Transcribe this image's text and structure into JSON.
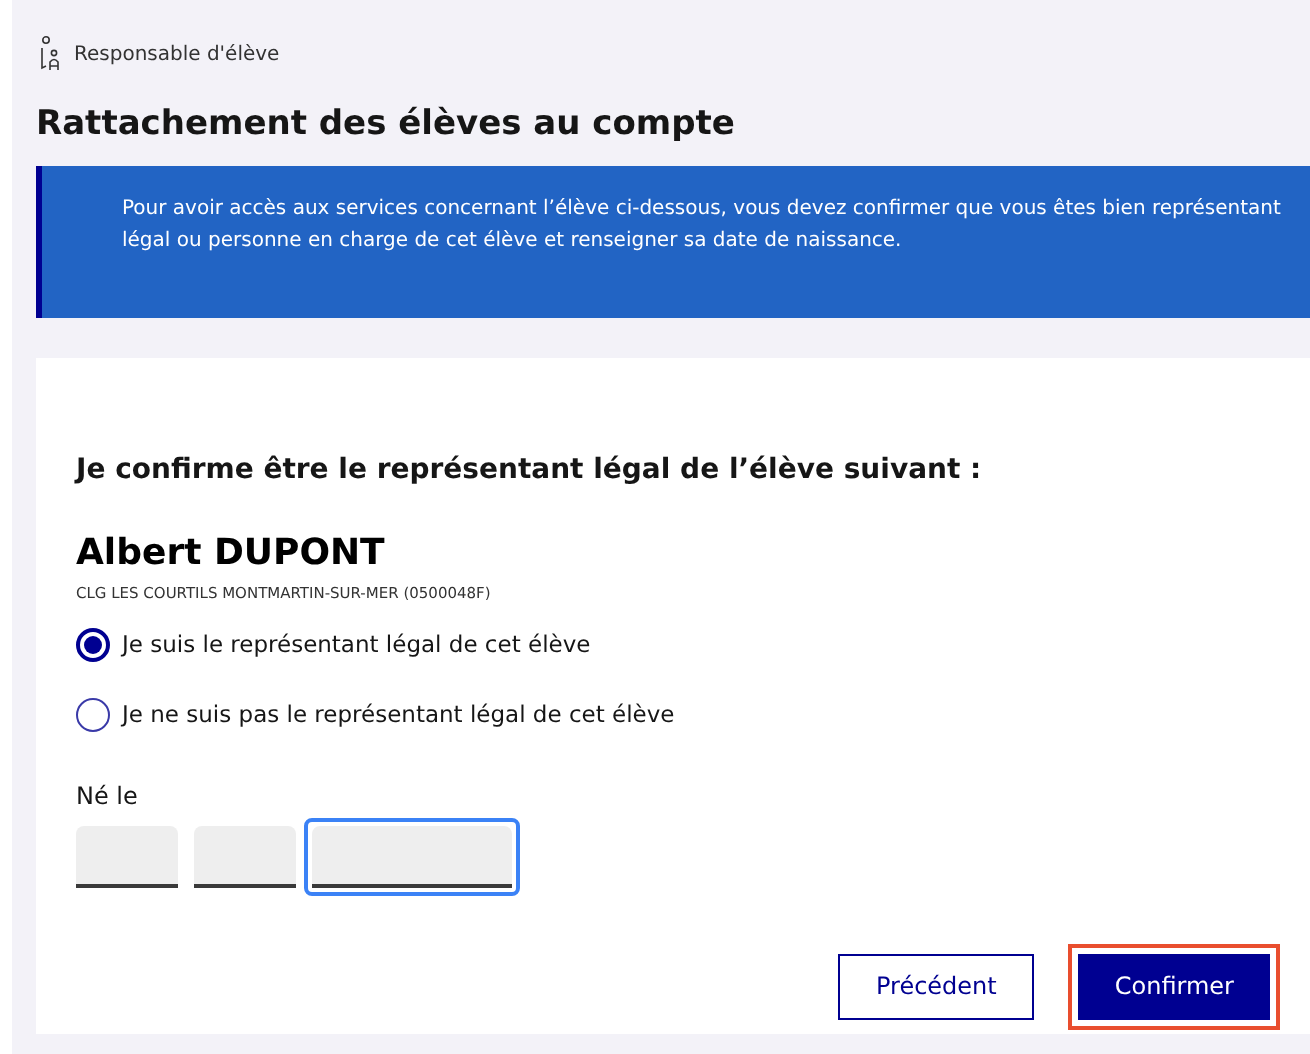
{
  "breadcrumb": {
    "label": "Responsable d'élève"
  },
  "title": "Rattachement des élèves au compte",
  "notice": "Pour avoir accès aux services concernant l’élève ci-dessous, vous devez confirmer que vous êtes bien représentant légal ou personne en charge de cet élève et renseigner sa date de naissance.",
  "form": {
    "heading": "Je confirme être le représentant légal de l’élève suivant :",
    "student_name": "Albert DUPONT",
    "school": "CLG LES COURTILS MONTMARTIN-SUR-MER (0500048F)",
    "options": [
      {
        "label": "Je suis le représentant légal de cet élève",
        "selected": true
      },
      {
        "label": "Je ne suis pas le représentant légal de cet élève",
        "selected": false
      }
    ],
    "birth_label": "Né le",
    "date_fields": [
      {
        "kind": "short",
        "focused": false
      },
      {
        "kind": "short",
        "focused": false
      },
      {
        "kind": "long",
        "focused": true
      }
    ],
    "buttons": [
      {
        "label": "Précédent",
        "kind": "secondary",
        "highlighted": false
      },
      {
        "label": "Confirmer",
        "kind": "primary",
        "highlighted": true
      }
    ]
  }
}
